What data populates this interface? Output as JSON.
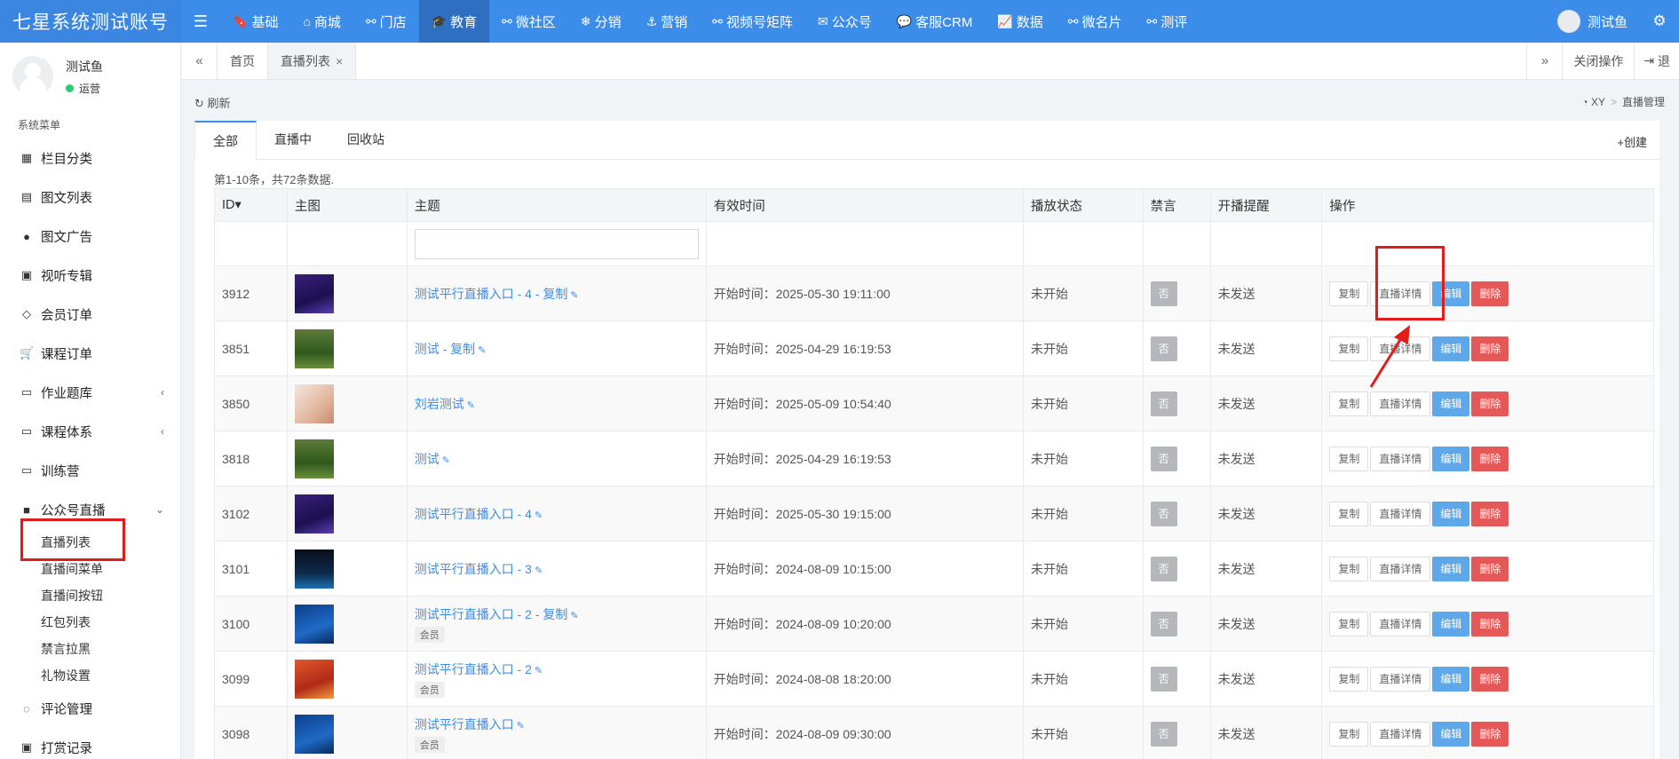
{
  "app": {
    "brand": "七星系统测试账号",
    "menu_toggle_icon": "menu-icon"
  },
  "topnav": [
    {
      "label": "基础",
      "icon": "bookmark-icon",
      "active": false
    },
    {
      "label": "商城",
      "icon": "store-icon",
      "active": false
    },
    {
      "label": "门店",
      "icon": "sitemap-icon",
      "active": false
    },
    {
      "label": "教育",
      "icon": "graduation-cap-icon",
      "active": true
    },
    {
      "label": "微社区",
      "icon": "sitemap-icon",
      "active": false
    },
    {
      "label": "分销",
      "icon": "snowflake-icon",
      "active": false
    },
    {
      "label": "营销",
      "icon": "anchor-icon",
      "active": false
    },
    {
      "label": "视频号矩阵",
      "icon": "sitemap-icon",
      "active": false
    },
    {
      "label": "公众号",
      "icon": "wechat-icon",
      "active": false
    },
    {
      "label": "客服CRM",
      "icon": "chat-icon",
      "active": false
    },
    {
      "label": "数据",
      "icon": "line-chart-icon",
      "active": false
    },
    {
      "label": "微名片",
      "icon": "sitemap-icon",
      "active": false
    },
    {
      "label": "测评",
      "icon": "sitemap-icon",
      "active": false
    }
  ],
  "user": {
    "name": "测试鱼",
    "status": "运营"
  },
  "sidebar": {
    "heading": "系统菜单",
    "items": [
      {
        "label": "栏目分类",
        "icon": "grid-icon"
      },
      {
        "label": "图文列表",
        "icon": "newspaper-icon"
      },
      {
        "label": "图文广告",
        "icon": "circle-icon"
      },
      {
        "label": "视听专辑",
        "icon": "file-audio-icon"
      },
      {
        "label": "会员订单",
        "icon": "diamond-icon"
      },
      {
        "label": "课程订单",
        "icon": "cart-icon"
      },
      {
        "label": "作业题库",
        "icon": "folder-icon",
        "chevron": "‹"
      },
      {
        "label": "课程体系",
        "icon": "folder-icon",
        "chevron": "‹"
      },
      {
        "label": "训练营",
        "icon": "folder-icon"
      },
      {
        "label": "公众号直播",
        "icon": "video-camera-icon",
        "chevron": "⌄"
      }
    ],
    "sub_items": [
      "直播列表",
      "直播间菜单",
      "直播间按钮",
      "红包列表",
      "禁言拉黑",
      "礼物设置"
    ],
    "bottom_items": [
      {
        "label": "评论管理",
        "icon": "comment-icon"
      },
      {
        "label": "打赏记录",
        "icon": "money-icon"
      }
    ]
  },
  "tabsbar": {
    "prev": "«",
    "next": "»",
    "tabs": [
      {
        "label": "首页",
        "active": false
      },
      {
        "label": "直播列表",
        "active": true,
        "close": "×"
      }
    ],
    "close_ops": "关闭操作",
    "exit": "退"
  },
  "content": {
    "refresh": "刷新",
    "breadcrumb": [
      "XY",
      "直播管理"
    ]
  },
  "panel": {
    "tabs": [
      "全部",
      "直播中",
      "回收站"
    ],
    "create": "创建",
    "summary": "第1-10条，共72条数据."
  },
  "table": {
    "columns": [
      "ID",
      "主图",
      "主题",
      "有效时间",
      "播放状态",
      "禁言",
      "开播提醒",
      "操作"
    ],
    "sort_indicator": "▾",
    "filter_placeholder": "",
    "actions": {
      "copy": "复制",
      "detail": "直播详情",
      "edit": "编辑",
      "delete": "删除"
    },
    "rows": [
      {
        "id": "3912",
        "thumb": "purple",
        "topic": "测试平行直播入口 - 4 - 复制",
        "member": "",
        "time": "开始时间：2025-05-30 19:11:00",
        "status": "未开始",
        "ban": "否",
        "remind": "未发送"
      },
      {
        "id": "3851",
        "thumb": "grass",
        "topic": "测试 - 复制",
        "member": "",
        "time": "开始时间：2025-04-29 16:19:53",
        "status": "未开始",
        "ban": "否",
        "remind": "未发送"
      },
      {
        "id": "3850",
        "thumb": "portrait",
        "topic": "刘岩测试",
        "member": "",
        "time": "开始时间：2025-05-09 10:54:40",
        "status": "未开始",
        "ban": "否",
        "remind": "未发送"
      },
      {
        "id": "3818",
        "thumb": "grass",
        "topic": "测试",
        "member": "",
        "time": "开始时间：2025-04-29 16:19:53",
        "status": "未开始",
        "ban": "否",
        "remind": "未发送"
      },
      {
        "id": "3102",
        "thumb": "purple",
        "topic": "测试平行直播入口 - 4",
        "member": "",
        "time": "开始时间：2025-05-30 19:15:00",
        "status": "未开始",
        "ban": "否",
        "remind": "未发送"
      },
      {
        "id": "3101",
        "thumb": "dark",
        "topic": "测试平行直播入口 - 3",
        "member": "",
        "time": "开始时间：2024-08-09 10:15:00",
        "status": "未开始",
        "ban": "否",
        "remind": "未发送"
      },
      {
        "id": "3100",
        "thumb": "blue",
        "topic": "测试平行直播入口 - 2 - 复制",
        "member": "会员",
        "time": "开始时间：2024-08-09 10:20:00",
        "status": "未开始",
        "ban": "否",
        "remind": "未发送"
      },
      {
        "id": "3099",
        "thumb": "orange",
        "topic": "测试平行直播入口 - 2",
        "member": "会员",
        "time": "开始时间：2024-08-08 18:20:00",
        "status": "未开始",
        "ban": "否",
        "remind": "未发送"
      },
      {
        "id": "3098",
        "thumb": "blue",
        "topic": "测试平行直播入口",
        "member": "会员",
        "time": "开始时间：2024-08-09 09:30:00",
        "status": "未开始",
        "ban": "否",
        "remind": "未发送"
      }
    ]
  },
  "colors": {
    "topbar": "#3c8dea",
    "link": "#3c8dea",
    "annotation": "#e31b1b",
    "edit": "#5ea7e8",
    "delete": "#e55858"
  }
}
